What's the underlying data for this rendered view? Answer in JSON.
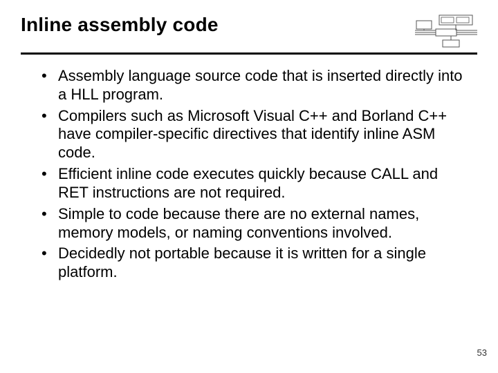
{
  "title": "Inline assembly code",
  "bullets": [
    "Assembly language source code that is inserted directly into a HLL program.",
    "Compilers such as Microsoft Visual C++ and Borland C++ have compiler-specific directives that identify inline ASM code.",
    "Efficient inline code executes quickly because CALL and RET instructions are not required.",
    "Simple to code because there are no external names, memory models, or naming conventions involved.",
    "Decidedly not portable because it is written for a single platform."
  ],
  "page_number": "53"
}
